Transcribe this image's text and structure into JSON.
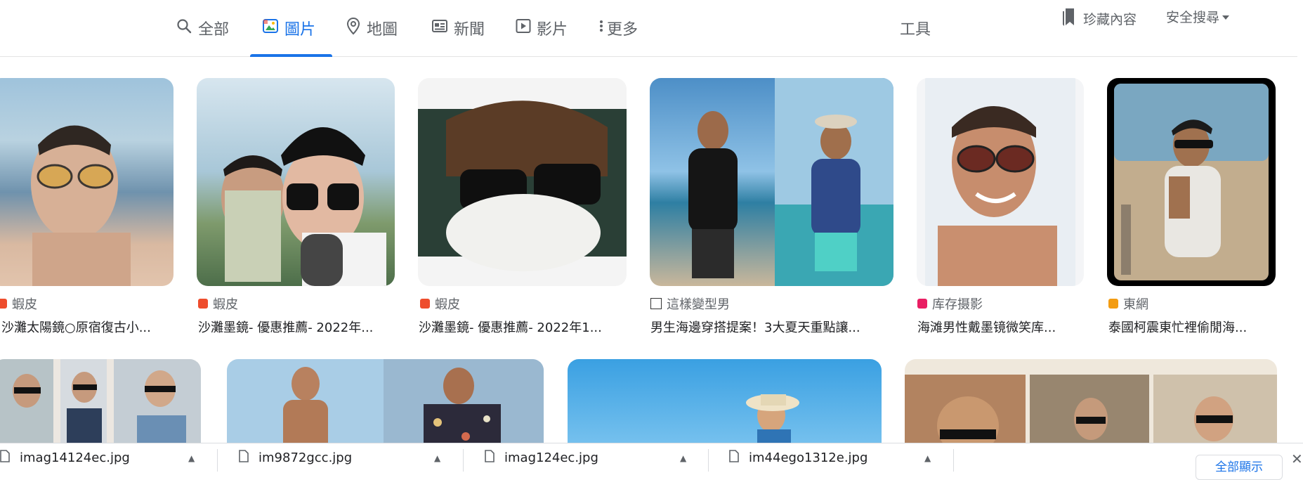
{
  "nav": {
    "tabs": [
      {
        "label": "全部"
      },
      {
        "label": "圖片"
      },
      {
        "label": "地圖"
      },
      {
        "label": "新聞"
      },
      {
        "label": "影片"
      },
      {
        "label": "更多"
      }
    ],
    "tools": "工具",
    "saved": "珍藏內容",
    "safe_search": "安全搜尋"
  },
  "results": [
    {
      "source": "蝦皮",
      "title": "沙灘太陽鏡○原宿復古小..."
    },
    {
      "source": "蝦皮",
      "title": "沙灘墨鏡- 優惠推薦- 2022年..."
    },
    {
      "source": "蝦皮",
      "title": "沙灘墨鏡- 優惠推薦- 2022年1..."
    },
    {
      "source": "這樣變型男",
      "title": "男生海邊穿搭提案！3大夏天重點讓..."
    },
    {
      "source": "库存摄影",
      "title": "海滩男性戴墨镜微笑库..."
    },
    {
      "source": "東網",
      "title": "泰國柯震東忙裡偷閒海..."
    }
  ],
  "downloads": {
    "files": [
      "imag14124ec.jpg",
      "im9872gcc.jpg",
      "imag124ec.jpg",
      "im44ego1312e.jpg"
    ],
    "show_all": "全部顯示"
  },
  "colors": {
    "accent": "#1a73e8",
    "muted": "#5f6368"
  }
}
